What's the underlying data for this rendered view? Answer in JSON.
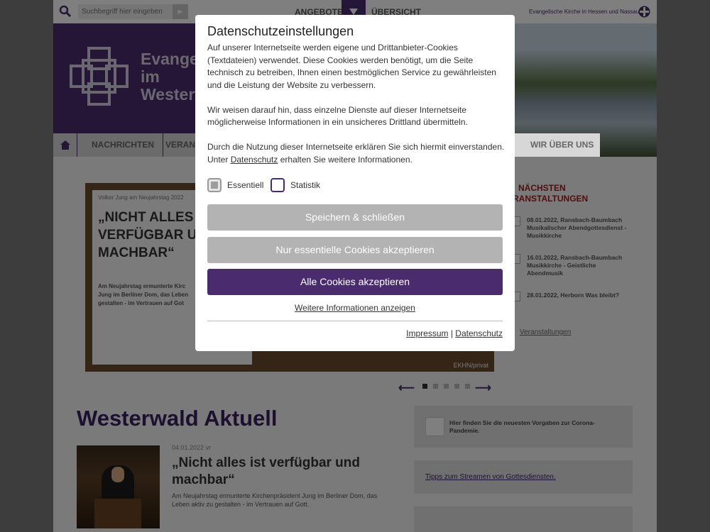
{
  "topbar": {
    "search_placeholder": "Suchbegriff hier eingeben",
    "search_go": "▶",
    "nav_offers": "ANGEBOTE",
    "nav_overview": "ÜBERSICHT",
    "ekhn_label": "Evangelische Kirche in Hessen und Nassau"
  },
  "header": {
    "logo_text_line1": "Evangel",
    "logo_text_line2": "im",
    "logo_text_line3": "Westerw",
    "brand_color": "#4a2c6e"
  },
  "mainnav": {
    "items": [
      {
        "label": "NACHRICHTEN"
      },
      {
        "label": "VERANS"
      },
      {
        "label": "WIR ÜBER UNS"
      }
    ]
  },
  "slider": {
    "kicker": "Volker Jung am Neujahrstag 2022",
    "headline_line1": "„NICHT ALLES IS",
    "headline_line2": "VERFÜGBAR UND",
    "headline_line3": "MACHBAR“",
    "teaser_line1": "Am Neujahrstag ermunterte Kirc",
    "teaser_line2": "Jung im Berliner Dom, das Leben",
    "teaser_line3": "gestalten - im Vertrauen auf Got",
    "credit": "EKHN/privat",
    "prev": "⟵",
    "next": "⟶",
    "active_dot": 0,
    "dot_count": 5
  },
  "events": {
    "title_line1": "NÄCHSTEN",
    "title_line2": "RANSTALTUNGEN",
    "items": [
      {
        "text": "08.01.2022, Ransbach-Baumbach Musikalischer Abendgottesdienst - Musikkirche"
      },
      {
        "text": "16.01.2022, Ransbach-Baumbach Musikkirche - Geistliche Abendmusik"
      },
      {
        "text": "28.01.2022, Herborn Was bleibt?"
      }
    ],
    "all_link": "Veranstaltungen"
  },
  "news": {
    "section_title": "Westerwald Aktuell",
    "date": "04.01.2022 vr",
    "headline": "„Nicht alles ist verfügbar und machbar“",
    "teaser": "Am Neujahrstag ermunterte Kirchenpräsident Jung im Berliner Dom, das Leben aktiv zu gestalten - im Vertrauen auf Gott."
  },
  "sidebar": {
    "corona_text": "Hier finden Sie die neuesten Vorgaben zur Corona-Pandemie.",
    "stream_link": "Tipps zum Streamen von Gottesdiensten."
  },
  "modal": {
    "title": "Datenschutzeinstellungen",
    "para1": "Auf unserer Internetseite werden eigene und Drittanbieter-Cookies (Textdateien) verwendet. Diese Cookies werden benötigt, um die Seite technisch zu betreiben, Ihnen einen bestmöglichen Service zu gewährleisten und die Leistung der Website zu verbessern.",
    "para2": "Wir weisen darauf hin, dass einzelne Dienste auf dieser Internetseite möglicherweise Informationen in ein unsicheres Drittland übermitteln.",
    "para3_start": "Durch die Nutzung dieser Internetseite erklären Sie sich hiermit einverstanden. Unter ",
    "para3_link": "Datenschutz",
    "para3_end": " erhalten Sie weitere Informationen.",
    "check_essential": "Essentiell",
    "check_statistic": "Statistik",
    "btn_save": "Speichern & schließen",
    "btn_essential": "Nur essentielle Cookies akzeptieren",
    "btn_all": "Alle Cookies akzeptieren",
    "more_info": "Weitere Informationen anzeigen",
    "footer_imprint": "Impressum",
    "footer_sep": "|",
    "footer_privacy": "Datenschutz"
  }
}
